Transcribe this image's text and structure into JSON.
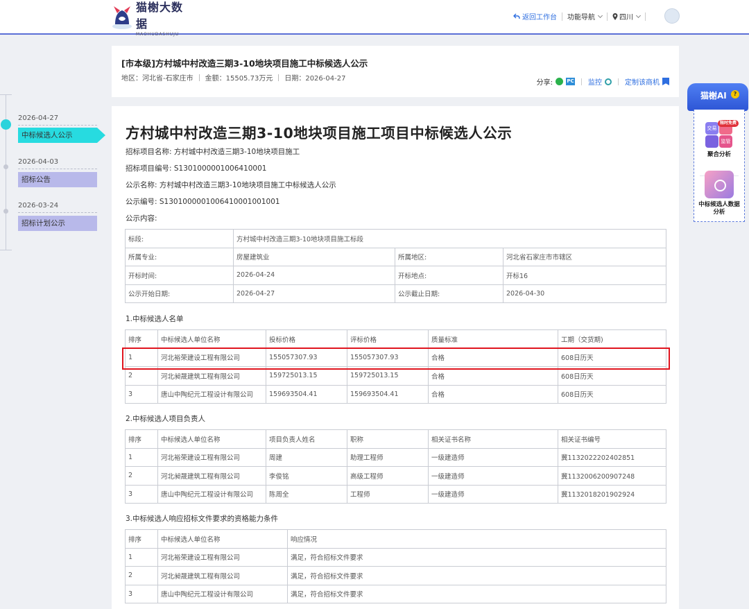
{
  "header": {
    "logo_cn": "猫榭大数据",
    "logo_en": "MAOHUDASHUJU",
    "back_label": "返回工作台",
    "nav_label": "功能导航",
    "region_label": "四川"
  },
  "summary": {
    "title": "[市本级]方村城中村改造三期3-10地块项目施工中标候选人公示",
    "region": "地区：河北省-石家庄市",
    "amount": "金额：15505.73万元",
    "date": "日期：2026-04-27",
    "share_label": "分享:",
    "pc_label": "PC",
    "monitor_label": "监控",
    "custom_label": "定制该商机"
  },
  "timeline": [
    {
      "date": "2026-04-27",
      "label": "中标候选人公示",
      "active": true
    },
    {
      "date": "2026-04-03",
      "label": "招标公告",
      "active": false
    },
    {
      "date": "2026-03-24",
      "label": "招标计划公示",
      "active": false
    }
  ],
  "document": {
    "title": "方村城中村改造三期3-10地块项目施工项目中标候选人公示",
    "fields": [
      "招标项目名称:  方村城中村改造三期3-10地块项目施工",
      "招标项目编号:  S1301000001006410001",
      "公示名称:  方村城中村改造三期3-10地块项目施工中标候选人公示",
      "公示编号:  S1301000001006410001001001",
      "公示内容:"
    ],
    "info_table": {
      "row0": [
        "标段:",
        "方村城中村改造三期3-10地块项目施工标段"
      ],
      "rows": [
        [
          "所属专业:",
          "房屋建筑业",
          "所属地区:",
          "河北省石家庄市市辖区"
        ],
        [
          "开标时间:",
          "2026-04-24",
          "开标地点:",
          "开标16"
        ],
        [
          "公示开始日期:",
          "2026-04-27",
          "公示截止日期:",
          "2026-04-30"
        ]
      ]
    },
    "section1": {
      "title": "1.中标候选人名单",
      "headers": [
        "排序",
        "中标候选人单位名称",
        "投标价格",
        "评标价格",
        "质量标准",
        "工期（交货期)"
      ],
      "rows": [
        [
          "1",
          "河北裕荣建设工程有限公司",
          "155057307.93",
          "155057307.93",
          "合格",
          "608日历天"
        ],
        [
          "2",
          "河北昶晟建筑工程有限公司",
          "159725013.15",
          "159725013.15",
          "合格",
          "608日历天"
        ],
        [
          "3",
          "唐山中陶纪元工程设计有限公司",
          "159693504.41",
          "159693504.41",
          "合格",
          "608日历天"
        ]
      ]
    },
    "section2": {
      "title": "2.中标候选人项目负责人",
      "headers": [
        "排序",
        "中标候选人单位名称",
        "项目负责人姓名",
        "职称",
        "相关证书名称",
        "相关证书编号"
      ],
      "rows": [
        [
          "1",
          "河北裕荣建设工程有限公司",
          "周建",
          "助理工程师",
          "一级建造师",
          "冀1132022202402851"
        ],
        [
          "2",
          "河北昶晟建筑工程有限公司",
          "李俊铭",
          "高级工程师",
          "一级建造师",
          "冀1132006200907248"
        ],
        [
          "3",
          "唐山中陶纪元工程设计有限公司",
          "陈周全",
          "工程师",
          "一级建造师",
          "冀1132018201902924"
        ]
      ]
    },
    "section3": {
      "title": "3.中标候选人响应招标文件要求的资格能力条件",
      "headers": [
        "排序",
        "中标候选人单位名称",
        "响应情况"
      ],
      "rows": [
        [
          "1",
          "河北裕荣建设工程有限公司",
          "满足，符合招标文件要求"
        ],
        [
          "2",
          "河北昶晟建筑工程有限公司",
          "满足，符合招标文件要求"
        ],
        [
          "3",
          "唐山中陶纪元工程设计有限公司",
          "满足，符合招标文件要求"
        ]
      ]
    }
  },
  "ai_panel": {
    "title": "猫榭AI",
    "badge": "限时免费",
    "icon_labels": [
      "交易",
      "监管"
    ],
    "card1": "聚合分析",
    "card2": "中标候选人数据分析"
  },
  "colors": {
    "accent": "#5b6fd6",
    "timeline_active": "#27dbe0",
    "timeline_item": "#b8b9ea",
    "highlight": "#e0141e",
    "link": "#2f6fe0"
  }
}
